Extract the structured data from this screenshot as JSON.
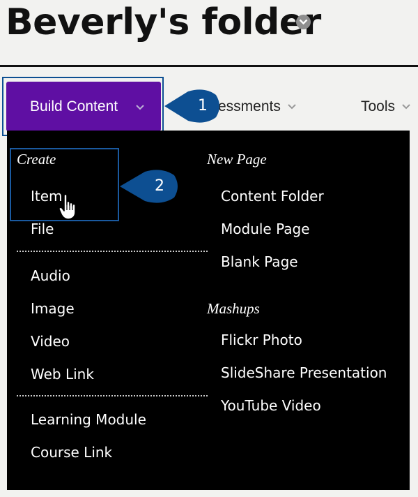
{
  "page": {
    "title": "Beverly's folder"
  },
  "nav": {
    "build_content": "Build Content",
    "assessments": "essments",
    "tools": "Tools"
  },
  "callouts": {
    "one": "1",
    "two": "2"
  },
  "menu": {
    "create": {
      "heading": "Create",
      "group1": [
        "Item",
        "File"
      ],
      "group2": [
        "Audio",
        "Image",
        "Video",
        "Web Link"
      ],
      "group3": [
        "Learning Module",
        "Course Link"
      ]
    },
    "new_page": {
      "heading": "New Page",
      "items": [
        "Content Folder",
        "Module Page",
        "Blank Page"
      ]
    },
    "mashups": {
      "heading": "Mashups",
      "items": [
        "Flickr Photo",
        "SlideShare Presentation",
        "YouTube Video"
      ]
    }
  },
  "colors": {
    "build_button": "#5f0fa3",
    "callout": "#0d4f92",
    "menu_bg": "#000000"
  },
  "icons": [
    "chevron-down-icon",
    "hand-pointer-icon"
  ]
}
